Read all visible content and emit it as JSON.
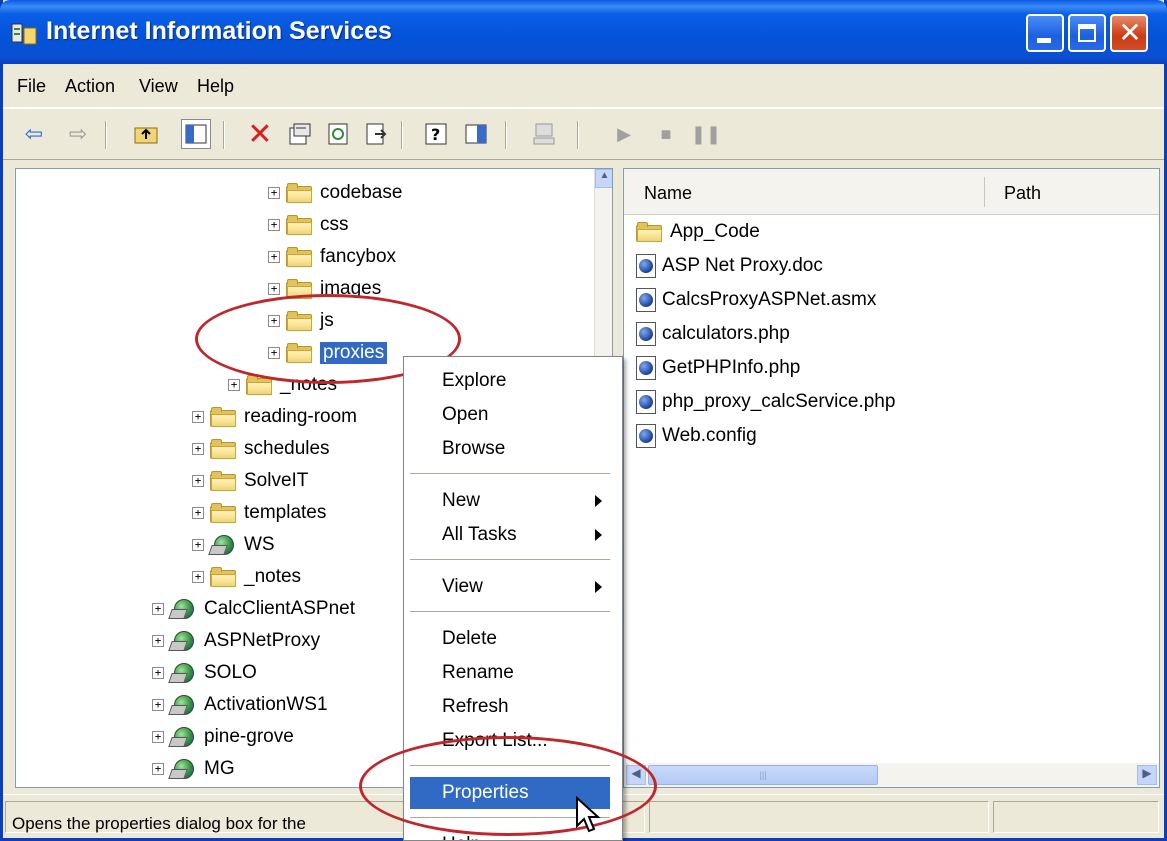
{
  "window": {
    "title": "Internet Information Services"
  },
  "menu": [
    "File",
    "Action",
    "View",
    "Help"
  ],
  "toolbar": {
    "icons": [
      "back-arrow-icon",
      "forward-arrow-icon",
      "up-folder-icon",
      "show-hide-tree-icon",
      "delete-icon",
      "properties-icon",
      "refresh-icon",
      "export-list-icon",
      "help-icon",
      "console-pane-icon",
      "computer-icon",
      "play-icon",
      "stop-icon",
      "pause-icon"
    ]
  },
  "tree": [
    {
      "label": "codebase",
      "type": "folder"
    },
    {
      "label": "css",
      "type": "folder"
    },
    {
      "label": "fancybox",
      "type": "folder"
    },
    {
      "label": "images",
      "type": "folder"
    },
    {
      "label": "js",
      "type": "folder"
    },
    {
      "label": "proxies",
      "type": "folder",
      "selected": true
    },
    {
      "label": "_notes",
      "type": "folder"
    },
    {
      "label": "reading-room",
      "type": "folder"
    },
    {
      "label": "schedules",
      "type": "folder"
    },
    {
      "label": "SolveIT",
      "type": "folder"
    },
    {
      "label": "templates",
      "type": "folder"
    },
    {
      "label": "WS",
      "type": "webapp"
    },
    {
      "label": "_notes",
      "type": "folder"
    },
    {
      "label": "CalcClientASPnet",
      "type": "webapp"
    },
    {
      "label": "ASPNetProxy",
      "type": "webapp"
    },
    {
      "label": "SOLO",
      "type": "webapp"
    },
    {
      "label": "ActivationWS1",
      "type": "webapp"
    },
    {
      "label": "pine-grove",
      "type": "webapp"
    },
    {
      "label": "MG",
      "type": "webapp"
    }
  ],
  "list": {
    "columns": [
      "Name",
      "Path"
    ],
    "items": [
      {
        "name": "App_Code",
        "type": "folder"
      },
      {
        "name": "ASP Net Proxy.doc",
        "type": "file"
      },
      {
        "name": "CalcsProxyASPNet.asmx",
        "type": "file"
      },
      {
        "name": "calculators.php",
        "type": "file"
      },
      {
        "name": "GetPHPInfo.php",
        "type": "file"
      },
      {
        "name": "php_proxy_calcService.php",
        "type": "file"
      },
      {
        "name": "Web.config",
        "type": "file"
      }
    ]
  },
  "context_menu": {
    "items": [
      {
        "label": "Explore"
      },
      {
        "label": "Open"
      },
      {
        "label": "Browse"
      },
      {
        "label": "New",
        "submenu": true
      },
      {
        "label": "All Tasks",
        "submenu": true
      },
      {
        "label": "View",
        "submenu": true
      },
      {
        "label": "Delete"
      },
      {
        "label": "Rename"
      },
      {
        "label": "Refresh"
      },
      {
        "label": "Export List..."
      },
      {
        "label": "Properties",
        "highlighted": true
      },
      {
        "label": "Help"
      }
    ]
  },
  "status": {
    "text": "Opens the properties dialog box for the"
  },
  "colors": {
    "titlebar": "#0a5ee6",
    "selection": "#316ac5",
    "annotation": "#c0272d"
  }
}
